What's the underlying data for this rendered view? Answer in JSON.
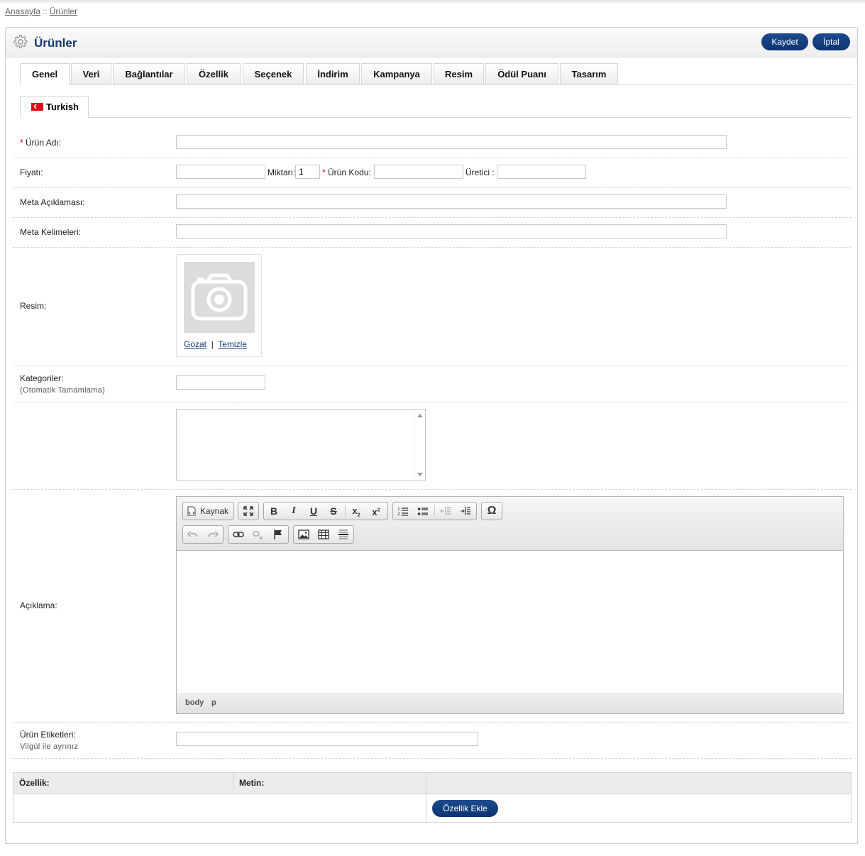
{
  "breadcrumb": {
    "home": "Anasayfa",
    "separator": "::",
    "current": "Ürünler"
  },
  "header": {
    "title": "Ürünler",
    "save_label": "Kaydet",
    "cancel_label": "İptal"
  },
  "tabs": [
    "Genel",
    "Veri",
    "Bağlantılar",
    "Özellik",
    "Seçenek",
    "İndirim",
    "Kampanya",
    "Resim",
    "Ödül Puanı",
    "Tasarım"
  ],
  "active_tab": "Genel",
  "language_tab": "Turkish",
  "form": {
    "required_mark": "*",
    "product_name_label": "Ürün Adı:",
    "price_label": "Fiyatı:",
    "quantity_label": "Miktarı:",
    "quantity_value": "1",
    "product_code_label": "Ürün Kodu:",
    "manufacturer_label": "Üretici :",
    "meta_description_label": "Meta Açıklaması:",
    "meta_keywords_label": "Meta Kelimeleri:",
    "image_label": "Resim:",
    "browse_label": "Gözat",
    "link_separator": "|",
    "clear_label": "Temizle",
    "categories_label": "Kategoriler:",
    "categories_hint": "(Otomatik Tamamlama)",
    "description_label": "Açıklama:",
    "tags_label": "Ürün Etiketleri:",
    "tags_hint": "Vilgül ile ayrınız"
  },
  "editor": {
    "source_label": "Kaynak",
    "path": [
      "body",
      "p"
    ]
  },
  "attributes_table": {
    "col_attribute": "Özellik:",
    "col_text": "Metin:",
    "add_button": "Özellik Ekle"
  },
  "colors": {
    "accent": "#0b3372",
    "title": "#16386a",
    "required": "#cc0000"
  }
}
